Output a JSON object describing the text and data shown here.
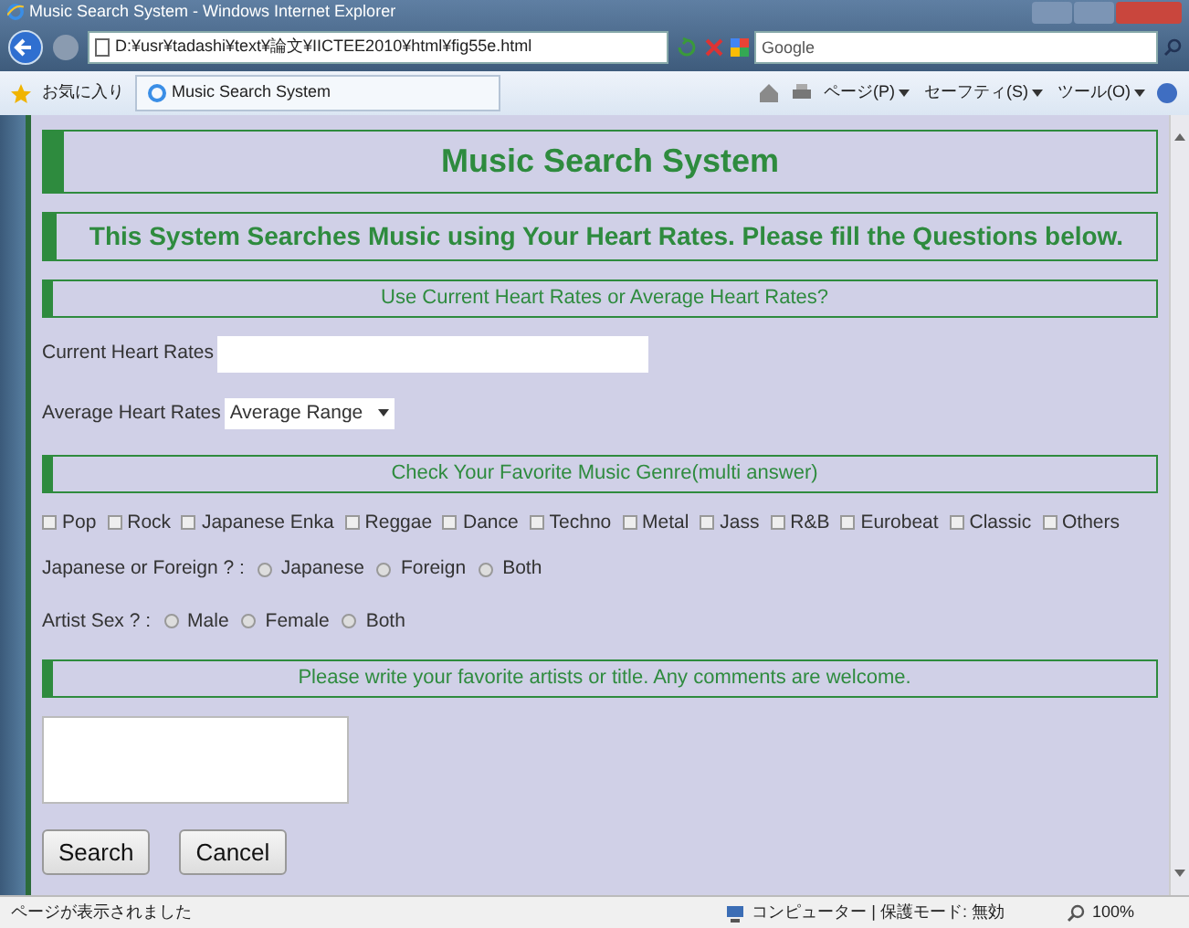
{
  "window": {
    "title": "Music Search System - Windows Internet Explorer"
  },
  "address_bar": {
    "url": "D:¥usr¥tadashi¥text¥論文¥IICTEE2010¥html¥fig55e.html",
    "search_placeholder": "Google"
  },
  "command_bar": {
    "favorites": "お気に入り",
    "tabs": [
      {
        "label": "Music Search System",
        "selected": true
      }
    ],
    "menus": [
      "ページ(P)",
      "セーフティ(S)",
      "ツール(O)"
    ]
  },
  "page": {
    "title": "Music Search System",
    "subtitle": "This System Searches Music using Your Heart Rates. Please fill the Questions below.",
    "sections": [
      {
        "kind": "heart",
        "heading": "Use Current Heart Rates or Average Heart Rates?",
        "current_label": "Current Heart Rates",
        "average_label": "Average Heart Rates",
        "average_value": "Average Range"
      },
      {
        "kind": "genre",
        "heading": "Check Your Favorite Music Genre(multi answer)",
        "genres": [
          {
            "label": "Pop",
            "checked": false
          },
          {
            "label": "Rock",
            "checked": false
          },
          {
            "label": "Japanese Enka",
            "checked": false
          },
          {
            "label": "Reggae",
            "checked": false
          },
          {
            "label": "Dance",
            "checked": false
          },
          {
            "label": "Techno",
            "checked": false
          },
          {
            "label": "Metal",
            "checked": false
          },
          {
            "label": "Jass",
            "checked": false
          },
          {
            "label": "R&B",
            "checked": false
          },
          {
            "label": "Eurobeat",
            "checked": false
          },
          {
            "label": "Classic",
            "checked": false
          },
          {
            "label": "Others",
            "checked": false
          }
        ],
        "questions": [
          {
            "label": "Japanese or Foreign ? :",
            "options": [
              {
                "label": "Japanese",
                "selected": false
              },
              {
                "label": "Foreign",
                "selected": false
              },
              {
                "label": "Both",
                "selected": false
              }
            ]
          },
          {
            "label": "Artist Sex ? :",
            "options": [
              {
                "label": "Male",
                "selected": false
              },
              {
                "label": "Female",
                "selected": false
              },
              {
                "label": "Both",
                "selected": false
              }
            ]
          }
        ]
      },
      {
        "kind": "comments",
        "heading": "Please write your favorite artists or title. Any comments are welcome."
      }
    ],
    "buttons": [
      "Search",
      "Cancel"
    ]
  },
  "status_bar": {
    "text": "ページが表示されました",
    "zone": "コンピューター | 保護モード: 無効",
    "zoom": "100%"
  }
}
